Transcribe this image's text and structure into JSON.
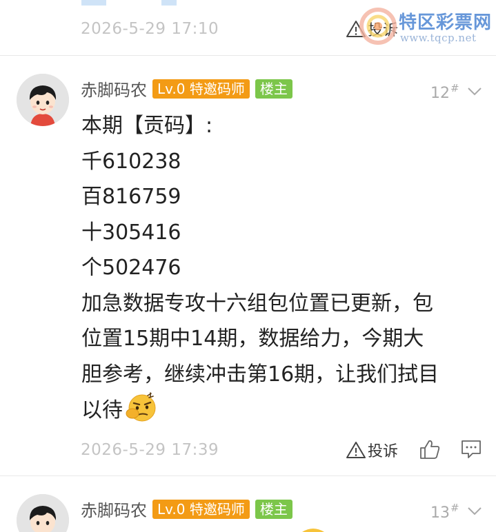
{
  "watermark": {
    "title": "特区彩票网",
    "url": "www.tqcp.net"
  },
  "prev_post": {
    "timestamp": "2026-5-29 17:10",
    "report_label": "投诉"
  },
  "post12": {
    "username": "赤脚码农",
    "level_badge": "Lv.0 特邀码师",
    "owner_badge": "楼主",
    "floor_number": "12",
    "floor_suffix": "#",
    "content_lines": [
      "本期【贡码】:",
      "千610238",
      "百816759",
      "十305416",
      "个502476",
      "加急数据专攻十六组包位置已更新，包",
      "位置15期中14期，数据给力，今期大",
      "胆参考，继续冲击第16期，让我们拭目",
      "以待"
    ],
    "timestamp": "2026-5-29 17:39",
    "report_label": "投诉"
  },
  "post13": {
    "username": "赤脚码农",
    "level_badge": "Lv.0 特邀码师",
    "owner_badge": "楼主",
    "floor_number": "13",
    "floor_suffix": "#"
  },
  "colors": {
    "level_badge": "#f39b15",
    "owner_badge": "#7cc64a",
    "timestamp": "#c4c4c4"
  },
  "icons": [
    "warning-triangle-icon",
    "thumbs-up-icon",
    "comment-bubble-icon",
    "chevron-down-icon",
    "thinking-emoji-icon"
  ]
}
